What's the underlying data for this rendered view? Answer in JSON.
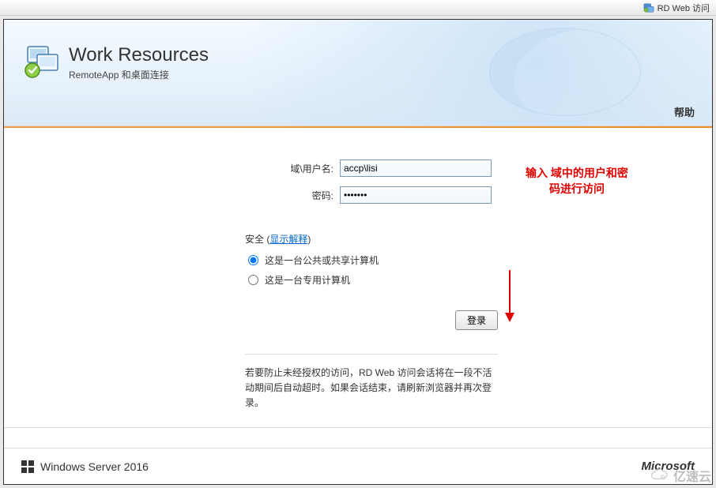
{
  "browser": {
    "tab_title": "RD Web 访问"
  },
  "header": {
    "title": "Work Resources",
    "subtitle": "RemoteApp 和桌面连接",
    "help": "帮助"
  },
  "form": {
    "username_label": "域\\用户名:",
    "username_value": "accp\\lisi",
    "password_label": "密码:",
    "password_value": "•••••••"
  },
  "security": {
    "heading_prefix": "安全",
    "show_explain": "显示解释",
    "option_public": "这是一台公共或共享计算机",
    "option_private": "这是一台专用计算机",
    "selected": "public"
  },
  "actions": {
    "signin": "登录"
  },
  "notice": {
    "text": "若要防止未经授权的访问，RD Web 访问会话将在一段不活动期间后自动超时。如果会话结束，请刷新浏览器并再次登录。"
  },
  "footer": {
    "windows": "Windows Server 2016",
    "microsoft": "Microsoft"
  },
  "annotation": {
    "line1": "输入  域中的用户和密",
    "line2": "码进行访问"
  },
  "watermark": {
    "text": "亿速云"
  },
  "icons": {
    "tab": "rdweb-icon",
    "logo": "remoteapp-logo-icon",
    "windows": "windows-logo-icon"
  }
}
